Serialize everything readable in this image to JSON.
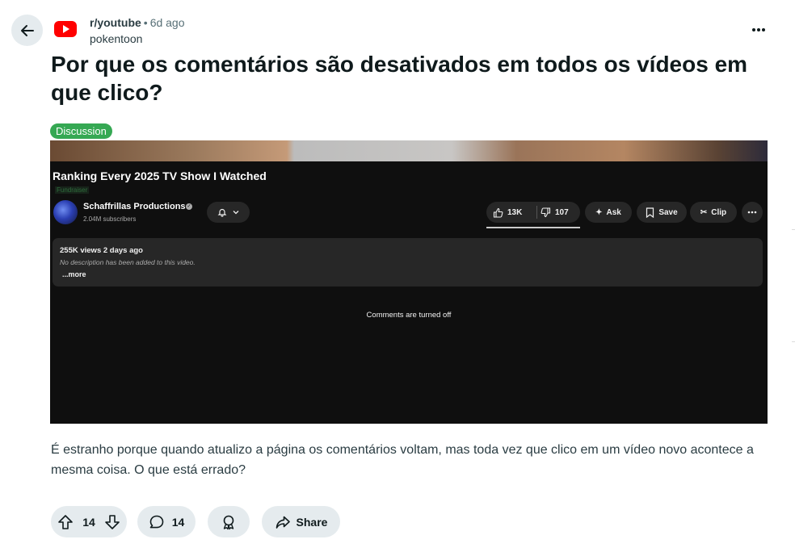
{
  "post": {
    "subreddit": "r/youtube",
    "separator": "•",
    "time": "6d ago",
    "author": "pokentoon",
    "title": "Por que os comentários são desativados em todos os vídeos em que clico?",
    "flair": "Discussion",
    "body": "É estranho porque quando atualizo a página os comentários voltam, mas toda vez que clico em um vídeo novo acontece a mesma coisa. O que está errado?"
  },
  "embedded_screenshot": {
    "video_title": "Ranking Every 2025 TV Show I Watched",
    "fundraiser": "Fundraiser",
    "channel_name": "Schaffrillas Productions",
    "subscribers": "2.04M subscribers",
    "likes": "13K",
    "dislikes": "107",
    "ask_label": "Ask",
    "save_label": "Save",
    "clip_label": "Clip",
    "views_line": "255K views  2 days ago",
    "description": "No description has been added to this video.",
    "more_link": "...more",
    "comments_off": "Comments are turned off"
  },
  "actions": {
    "votes": "14",
    "comments": "14",
    "share": "Share"
  },
  "colors": {
    "youtube_red": "#ff0000",
    "flair_green": "#35a853",
    "action_bg": "#e5ebee"
  },
  "icons": [
    "back-arrow-icon",
    "youtube-logo-icon",
    "more-options-icon",
    "upvote-icon",
    "downvote-icon",
    "comment-icon",
    "award-icon",
    "share-icon"
  ]
}
